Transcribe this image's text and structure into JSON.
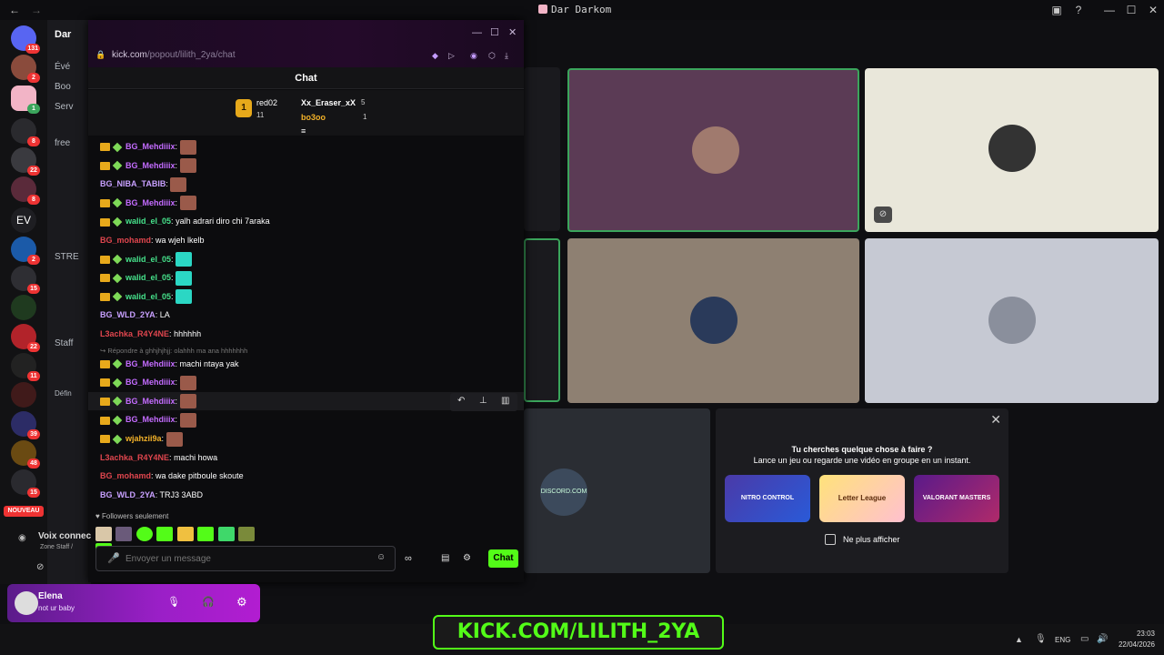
{
  "window": {
    "title": "Dar Darkom"
  },
  "rail": {
    "badges": [
      "131",
      "2",
      "1",
      "8",
      "22",
      "8",
      "2",
      "15",
      "22",
      "11",
      "39",
      "48",
      "15"
    ],
    "new_label": "NOUVEAU"
  },
  "sidebar": {
    "server_name": "Dar",
    "items": [
      "Évé",
      "Boo",
      "Serv",
      "free",
      "STRE",
      "Staff",
      "Défin"
    ]
  },
  "kick": {
    "url_host": "kick.com",
    "url_path": "/popout/lilith_2ya/chat",
    "header": "Chat",
    "leaderboard": [
      {
        "rank": "1",
        "name": "red02",
        "count": "11"
      },
      {
        "name": "Xx_Eraser_xX",
        "count": "5"
      },
      {
        "name": "bo3oo",
        "count": "1"
      }
    ],
    "messages": [
      {
        "user": "BG_Mehdiiix",
        "text": "",
        "color": "#c46cff",
        "badges": true,
        "emote": true
      },
      {
        "user": "BG_Mehdiiix",
        "text": "",
        "color": "#c46cff",
        "badges": true,
        "emote": true
      },
      {
        "user": "BG_NIBA_TABIB",
        "text": "",
        "color": "#c8a0ff",
        "badges": false,
        "emote": true
      },
      {
        "user": "BG_Mehdiiix",
        "text": "",
        "color": "#c46cff",
        "badges": true,
        "emote": true
      },
      {
        "user": "walid_el_05",
        "text": "yalh adrari diro chi 7araka",
        "color": "#46e28b",
        "badges": true,
        "emote": false
      },
      {
        "user": "BG_mohamd",
        "text": "wa wjeh lkelb",
        "color": "#e0464e",
        "badges": false,
        "emote": false
      },
      {
        "user": "walid_el_05",
        "text": "",
        "color": "#46e28b",
        "badges": true,
        "emote": true
      },
      {
        "user": "walid_el_05",
        "text": "",
        "color": "#46e28b",
        "badges": true,
        "emote": true
      },
      {
        "user": "walid_el_05",
        "text": "",
        "color": "#46e28b",
        "badges": true,
        "emote": true
      },
      {
        "user": "BG_WLD_2YA",
        "text": "LA",
        "color": "#c8a0ff",
        "badges": false,
        "emote": false
      },
      {
        "user": "L3achka_R4Y4NE",
        "text": "hhhhhh",
        "color": "#e0464e",
        "badges": false,
        "emote": false
      }
    ],
    "reply_hint": "Répondre à ghhjhjhjj: olahhh ma ana hhhhhhh",
    "messages2": [
      {
        "user": "BG_Mehdiiix",
        "text": "machi ntaya yak",
        "color": "#c46cff",
        "badges": true,
        "emote": false
      },
      {
        "user": "BG_Mehdiiix",
        "text": "",
        "color": "#c46cff",
        "badges": true,
        "emote": true
      },
      {
        "user": "BG_Mehdiiix",
        "text": "",
        "color": "#c46cff",
        "badges": true,
        "emote": true
      },
      {
        "user": "BG_Mehdiiix",
        "text": "",
        "color": "#c46cff",
        "badges": true,
        "emote": true
      },
      {
        "user": "wjahzii9a",
        "text": "",
        "color": "#f3b229",
        "badges": true,
        "emote": true
      },
      {
        "user": "L3achka_R4Y4NE",
        "text": "machi howa",
        "color": "#e0464e",
        "badges": false,
        "emote": false
      },
      {
        "user": "BG_mohamd",
        "text": "wa dake pitboule skoute",
        "color": "#e0464e",
        "badges": false,
        "emote": false
      },
      {
        "user": "BG_WLD_2YA",
        "text": "TRJ3 3ABD",
        "color": "#c8a0ff",
        "badges": false,
        "emote": false
      }
    ],
    "followers_only": "Followers seulement",
    "composer_placeholder": "Envoyer un message",
    "chat_button": "Chat"
  },
  "voice": {
    "promo_title": "Tu cherches quelque chose à faire ?",
    "promo_sub": "Lance un jeu ou regarde une vidéo en groupe en un instant.",
    "promo_cards": [
      "NITRO CONTROL",
      "Letter League",
      "VALORANT MASTERS"
    ],
    "checkbox_label": "Ne plus afficher",
    "tile_watermark": "DISCORD.COM"
  },
  "voice_status": {
    "label": "Voix connec",
    "sub": "Zone Staff /"
  },
  "user": {
    "name": "Elena",
    "status": "not ur baby"
  },
  "taskbar": {
    "lang": "ENG",
    "time": "23:03",
    "date": "22/04/2026"
  },
  "banner": {
    "text": "KICK.COM/LILITH_2YA"
  },
  "colors": {
    "kick_green": "#53fc18",
    "speaking_green": "#3ba55c"
  }
}
